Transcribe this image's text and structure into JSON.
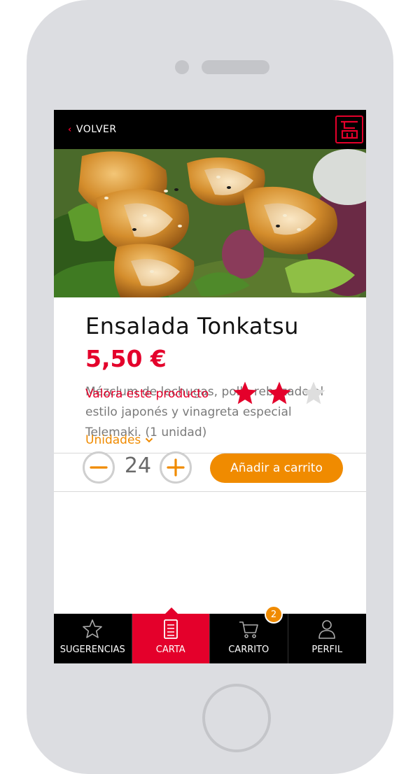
{
  "header": {
    "back_label": "VOLVER",
    "logo_icon": "telemaki-logo"
  },
  "product": {
    "image_icon": "food-photo",
    "title": "Ensalada Tonkatsu",
    "price": "5,50 €",
    "description": "Mézclum de lechugas, pollo rebozado al estilo japonés y vinagreta especial Telemaki. (1 unidad)"
  },
  "rating": {
    "label": "Valora este producto",
    "value": 2,
    "max": 3
  },
  "order": {
    "units_label": "Unidades",
    "quantity": "24",
    "add_label": "Añadir a carrito"
  },
  "tabs": [
    {
      "label": "SUGERENCIAS",
      "icon": "star-outline-icon",
      "active": false
    },
    {
      "label": "CARTA",
      "icon": "menu-card-icon",
      "active": true
    },
    {
      "label": "CARRITO",
      "icon": "cart-icon",
      "active": false,
      "badge": "2"
    },
    {
      "label": "PERFIL",
      "icon": "user-icon",
      "active": false
    }
  ],
  "colors": {
    "brand_red": "#e4002b",
    "accent_orange": "#f08b00",
    "bar_black": "#000000"
  }
}
